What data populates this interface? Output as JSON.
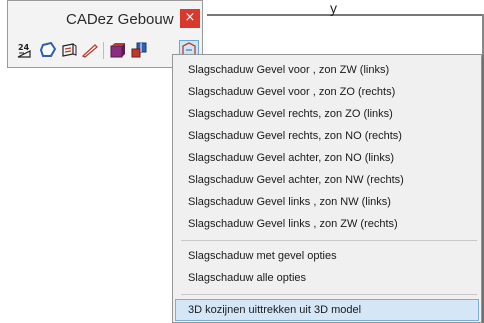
{
  "background": {
    "text_fragment": "y"
  },
  "toolbar": {
    "title": "CADez Gebouw",
    "close_label": "×",
    "icons": [
      "roof-pitch-icon",
      "polygon-icon",
      "wall-tool-icon",
      "pen-icon",
      "block-icon",
      "window-icon",
      "shadow-icon"
    ]
  },
  "menu": {
    "group1": [
      "Slagschaduw Gevel voor  , zon ZW (links)",
      "Slagschaduw Gevel voor  , zon ZO (rechts)",
      "Slagschaduw Gevel rechts, zon ZO (links)",
      "Slagschaduw Gevel rechts, zon NO (rechts)",
      "Slagschaduw Gevel achter, zon NO (links)",
      "Slagschaduw Gevel achter, zon NW (rechts)",
      "Slagschaduw Gevel links , zon NW (links)",
      "Slagschaduw Gevel links , zon ZW (rechts)"
    ],
    "group2": [
      "Slagschaduw met gevel opties",
      "Slagschaduw alle opties"
    ],
    "group3": [
      "3D kozijnen uittrekken uit 3D model"
    ]
  },
  "colors": {
    "close_button": "#d9382c",
    "highlight": "#d5e7f7",
    "highlight_border": "#7ab0dc"
  }
}
